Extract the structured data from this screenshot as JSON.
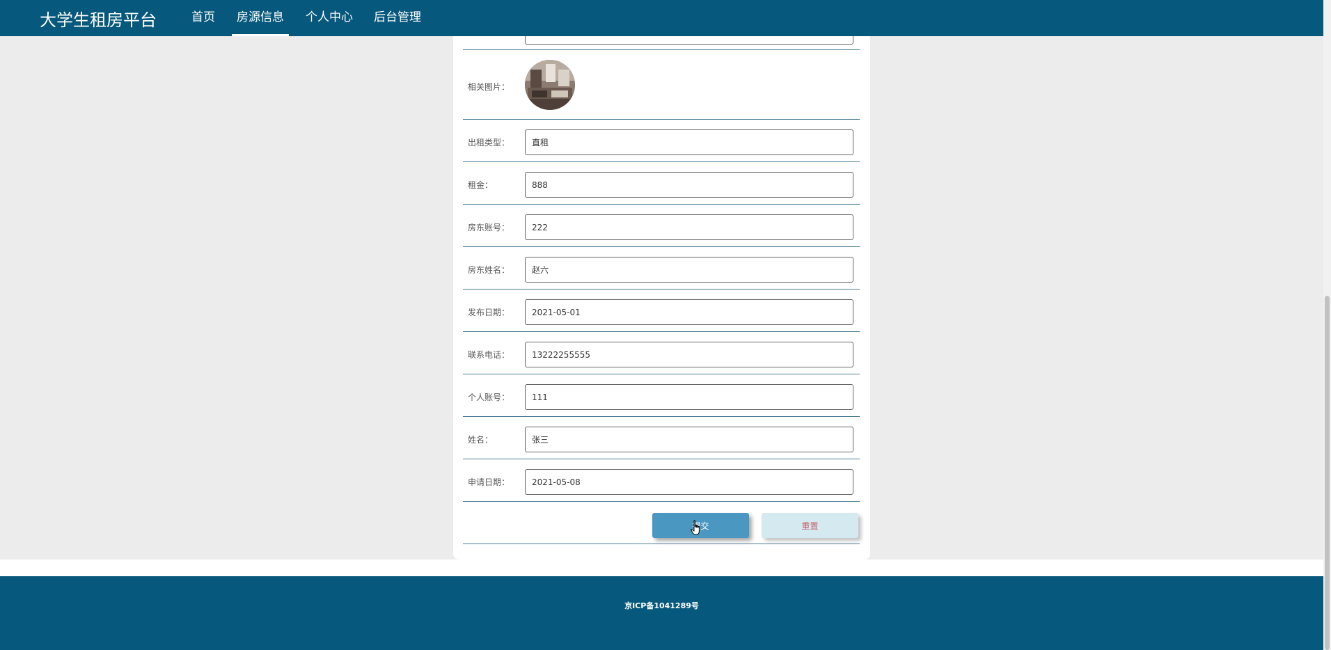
{
  "header": {
    "brand": "大学生租房平台",
    "nav": [
      {
        "label": "首页",
        "active": false
      },
      {
        "label": "房源信息",
        "active": true
      },
      {
        "label": "个人中心",
        "active": false
      },
      {
        "label": "后台管理",
        "active": false
      }
    ]
  },
  "form": {
    "image_label": "相关图片：",
    "fields": [
      {
        "label": "出租类型：",
        "value": "直租"
      },
      {
        "label": "租金：",
        "value": "888"
      },
      {
        "label": "房东账号：",
        "value": "222"
      },
      {
        "label": "房东姓名：",
        "value": "赵六"
      },
      {
        "label": "发布日期：",
        "value": "2021-05-01"
      },
      {
        "label": "联系电话：",
        "value": "13222255555"
      },
      {
        "label": "个人账号：",
        "value": "111"
      },
      {
        "label": "姓名：",
        "value": "张三"
      },
      {
        "label": "申请日期：",
        "value": "2021-05-08"
      }
    ],
    "submit_label": "提交",
    "reset_label": "重置"
  },
  "footer": {
    "icp": "京ICP备1041289号"
  },
  "colors": {
    "primary": "#06587c",
    "submit": "#4a97c1",
    "reset_bg": "#d5e9f0",
    "reset_text": "#c3656b"
  }
}
